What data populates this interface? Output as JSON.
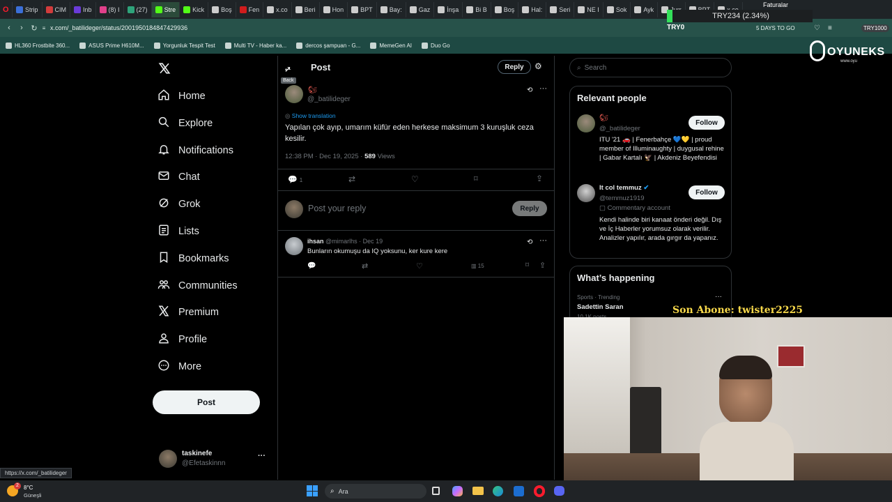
{
  "browser": {
    "tabs": [
      {
        "label": "Strip",
        "color": "#3b6fd8"
      },
      {
        "label": "CIM",
        "color": "#d23c3c"
      },
      {
        "label": "Inb",
        "color": "#6a3bd8"
      },
      {
        "label": "(8) I",
        "color": "#e0408a"
      },
      {
        "label": "(27)",
        "color": "#2ea37a"
      },
      {
        "label": "Stre",
        "color": "#53fc18"
      },
      {
        "label": "Kick",
        "color": "#53fc18"
      },
      {
        "label": "Boş",
        "color": "#cccccc"
      },
      {
        "label": "Fen",
        "color": "#d01c1c"
      },
      {
        "label": "x.co",
        "color": "#cccccc"
      },
      {
        "label": "Beri",
        "color": "#cccccc"
      },
      {
        "label": "Hon",
        "color": "#cccccc"
      },
      {
        "label": "BPT",
        "color": "#cccccc"
      },
      {
        "label": "Bay:",
        "color": "#cccccc"
      },
      {
        "label": "Gaz",
        "color": "#cccccc"
      },
      {
        "label": "İnşa",
        "color": "#cccccc"
      },
      {
        "label": "Bi B",
        "color": "#cccccc"
      },
      {
        "label": "Boş",
        "color": "#cccccc"
      },
      {
        "label": "Hal:",
        "color": "#cccccc"
      },
      {
        "label": "Seri",
        "color": "#cccccc"
      },
      {
        "label": "NE I",
        "color": "#cccccc"
      },
      {
        "label": "Sok",
        "color": "#cccccc"
      },
      {
        "label": "Ayk",
        "color": "#cccccc"
      },
      {
        "label": "Jurr",
        "color": "#cccccc"
      },
      {
        "label": "BPT",
        "color": "#cccccc"
      },
      {
        "label": "x.co",
        "color": "#cccccc"
      }
    ],
    "url": "x.com/_batilideger/status/2001950184847429936",
    "bookmarks": [
      "HL360 Frostbite 360...",
      "ASUS Prime H610M...",
      "Yorgunluk Tespit Test",
      "Multi TV - Haber ka...",
      "dercos şampuan - G...",
      "MemeGen AI",
      "Duo Go"
    ],
    "status_url": "https://x.com/_batilideger"
  },
  "overlay": {
    "ticker": "TRY234 (2.34%)",
    "ticker_label": "TRY0",
    "days": "5 DAYS TO GO",
    "ticker_right": "TRY1000",
    "fatura": "Faturalar",
    "brand": "OYUNEKS",
    "brand_sub": "www.oyu",
    "subscriber": "Son Abone: twister2225"
  },
  "nav": {
    "items": [
      {
        "label": "Home",
        "icon": "home-icon"
      },
      {
        "label": "Explore",
        "icon": "search-icon"
      },
      {
        "label": "Notifications",
        "icon": "bell-icon"
      },
      {
        "label": "Chat",
        "icon": "mail-icon"
      },
      {
        "label": "Grok",
        "icon": "grok-icon"
      },
      {
        "label": "Lists",
        "icon": "list-icon"
      },
      {
        "label": "Bookmarks",
        "icon": "bookmark-icon"
      },
      {
        "label": "Communities",
        "icon": "communities-icon"
      },
      {
        "label": "Premium",
        "icon": "x-logo-icon"
      },
      {
        "label": "Profile",
        "icon": "person-icon"
      },
      {
        "label": "More",
        "icon": "more-circle-icon"
      }
    ],
    "post_label": "Post",
    "account": {
      "name": "taskinefe",
      "handle": "@Efetaskinnn"
    }
  },
  "post": {
    "header_title": "Post",
    "reply_label": "Reply",
    "back_tooltip": "Back",
    "author_handle": "@_batilideger",
    "translate": "Show translation",
    "text": "Yapılan çok ayıp, umarım küfür eden herkese maksimum 3 kuruşluk ceza kesilir.",
    "time": "12:38 PM · Dec 19, 2025 ·",
    "views_count": "589",
    "views_label": "Views",
    "reply_count": "1",
    "reply_placeholder": "Post your reply",
    "reply_button": "Reply"
  },
  "reply": {
    "name": "ihsan",
    "handle": "@mimarlhs · Dec 19",
    "text": "Bunların okumuşu da IQ yoksunu,  ker kure kere",
    "views": "15"
  },
  "sidebar": {
    "search_placeholder": "Search",
    "relevant_title": "Relevant people",
    "people": [
      {
        "handle": "@_batilideger",
        "bio": "ITU '21 🚗 | Fenerbahçe 💙💛 | proud member of Illuminaughty | duygusal rehine | Gabar Kartalı 🦅 | Akdeniz Beyefendisi",
        "follow": "Follow",
        "subtitle": ""
      },
      {
        "name": "It col temmuz",
        "handle": "@temmuz1919",
        "subtitle": "Commentary account",
        "bio": "Kendi halinde biri kanaat önderi değil. Dış ve İç Haberler yorumsuz olarak verilir. Analizler yapılır, arada gırgır da yapanız.",
        "follow": "Follow"
      }
    ],
    "happening_title": "What’s happening",
    "trend_category": "Sports · Trending",
    "trend_name": "Sadettin Saran",
    "trend_count": "10.1K posts"
  },
  "taskbar": {
    "weather_temp": "8°C",
    "weather_desc": "Güneşli",
    "weather_badge": "2",
    "search_placeholder": "Ara"
  }
}
